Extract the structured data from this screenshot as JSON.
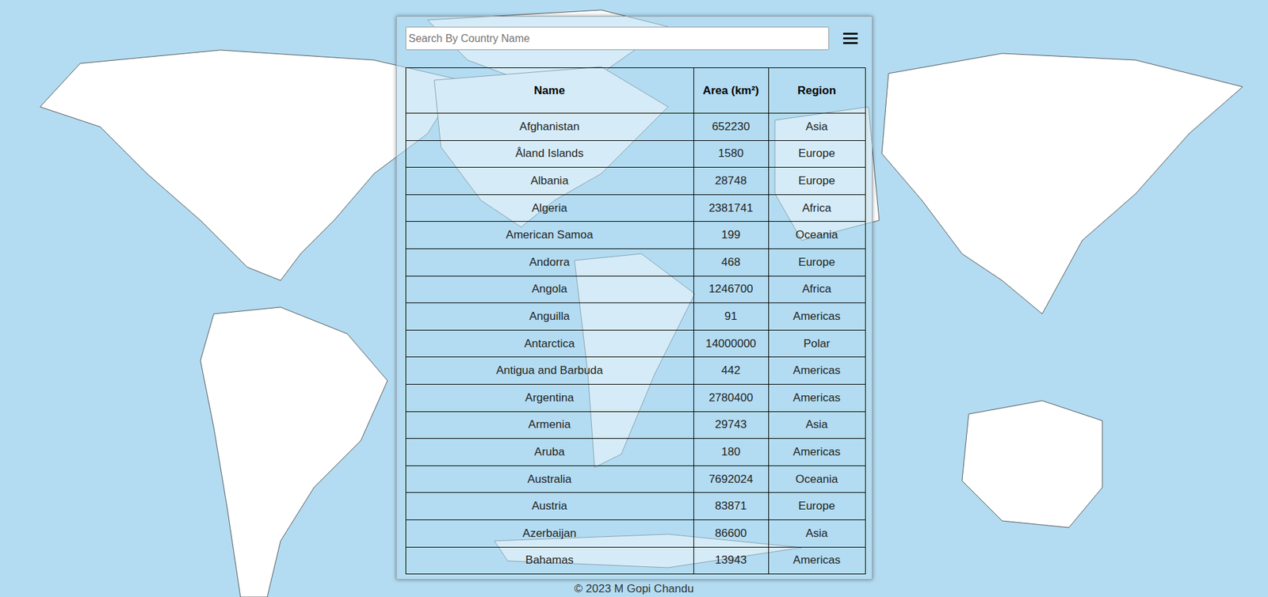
{
  "search": {
    "placeholder": "Search By Country Name"
  },
  "table": {
    "columns": [
      "Name",
      "Area (km²)",
      "Region"
    ],
    "rows": [
      [
        "Afghanistan",
        "652230",
        "Asia"
      ],
      [
        "Åland Islands",
        "1580",
        "Europe"
      ],
      [
        "Albania",
        "28748",
        "Europe"
      ],
      [
        "Algeria",
        "2381741",
        "Africa"
      ],
      [
        "American Samoa",
        "199",
        "Oceania"
      ],
      [
        "Andorra",
        "468",
        "Europe"
      ],
      [
        "Angola",
        "1246700",
        "Africa"
      ],
      [
        "Anguilla",
        "91",
        "Americas"
      ],
      [
        "Antarctica",
        "14000000",
        "Polar"
      ],
      [
        "Antigua and Barbuda",
        "442",
        "Americas"
      ],
      [
        "Argentina",
        "2780400",
        "Americas"
      ],
      [
        "Armenia",
        "29743",
        "Asia"
      ],
      [
        "Aruba",
        "180",
        "Americas"
      ],
      [
        "Australia",
        "7692024",
        "Oceania"
      ],
      [
        "Austria",
        "83871",
        "Europe"
      ],
      [
        "Azerbaijan",
        "86600",
        "Asia"
      ],
      [
        "Bahamas",
        "13943",
        "Americas"
      ]
    ]
  },
  "footer": "© 2023 M Gopi Chandu"
}
